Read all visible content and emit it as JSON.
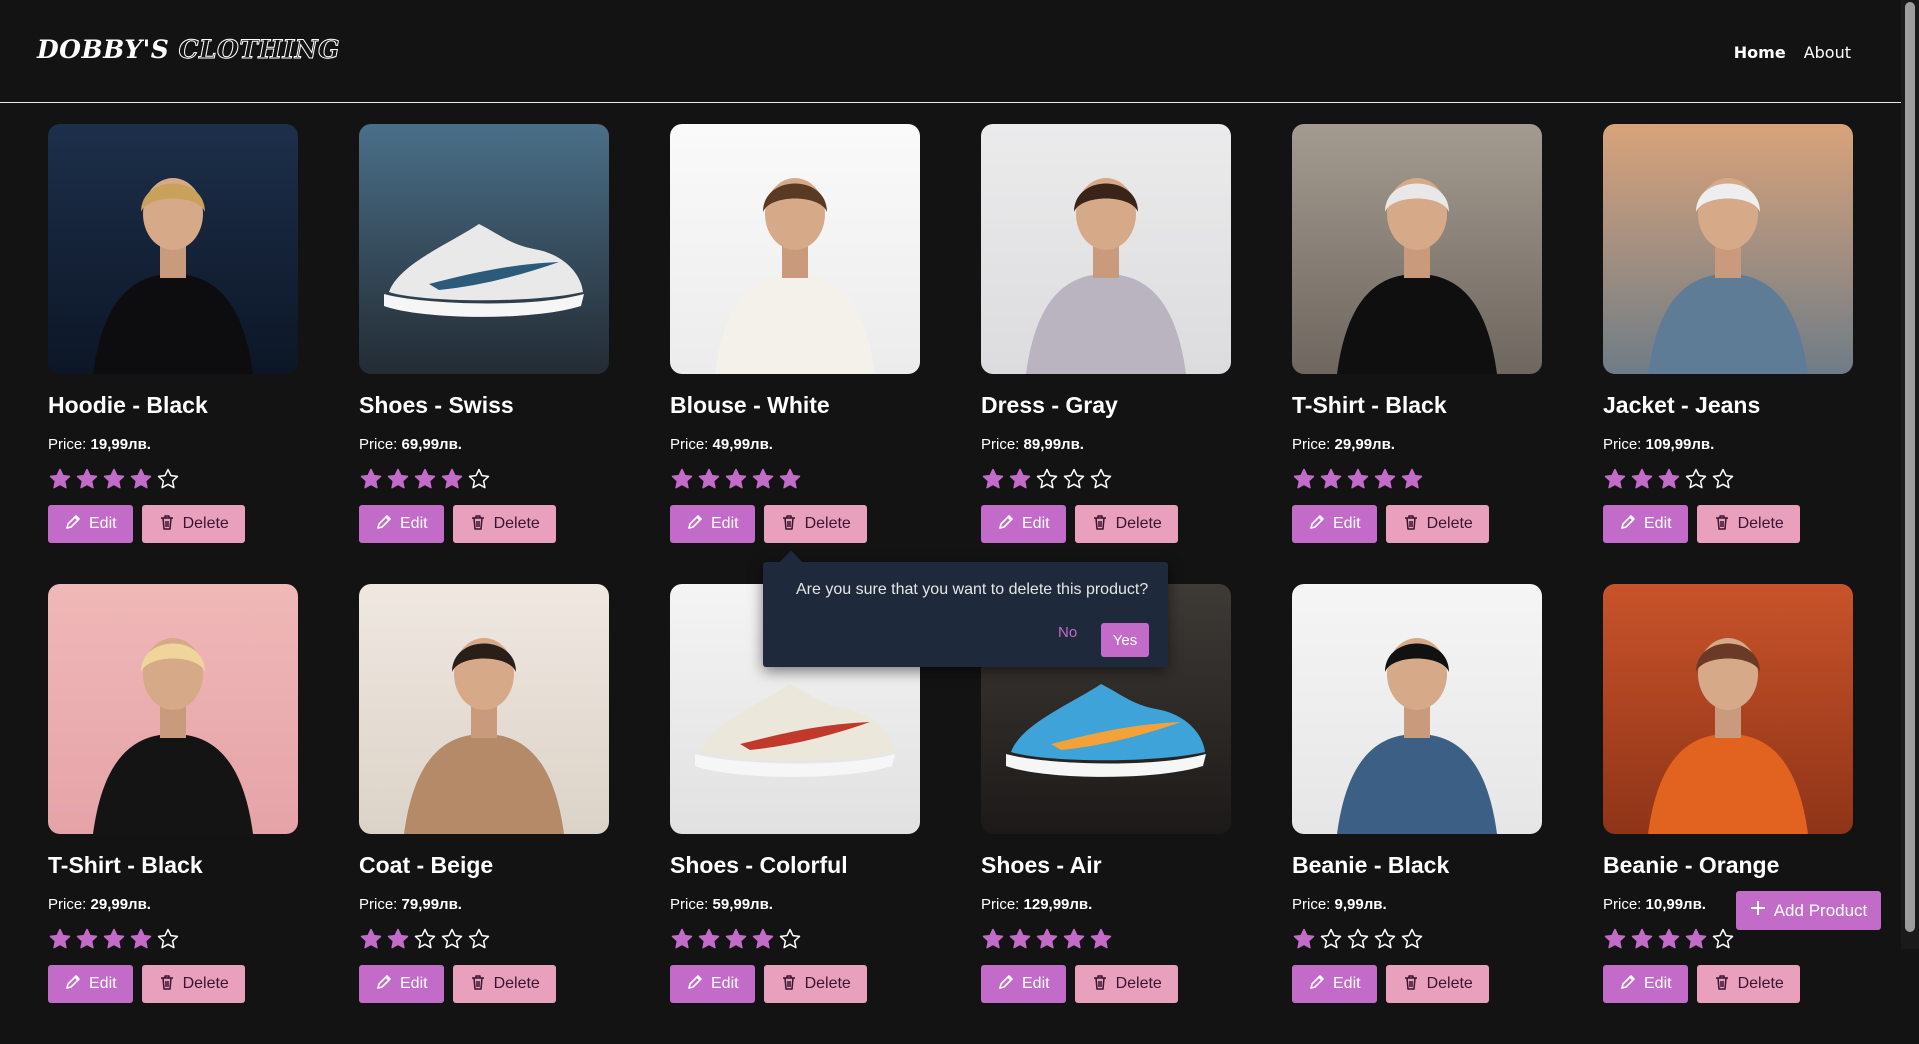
{
  "brand": {
    "logo_part1": "DOBBY'S",
    "logo_part2": "CLOTHING"
  },
  "nav": {
    "home": "Home",
    "about": "About"
  },
  "labels": {
    "price": "Price:",
    "edit": "Edit",
    "delete": "Delete"
  },
  "colors": {
    "accent": "#c36bc8",
    "delete_bg": "#e9a0bc",
    "background": "#131314",
    "popover_bg": "#1e293b"
  },
  "products": [
    {
      "title": "Hoodie - Black",
      "price": "19,99лв.",
      "rating": 4
    },
    {
      "title": "Shoes - Swiss",
      "price": "69,99лв.",
      "rating": 4
    },
    {
      "title": "Blouse - White",
      "price": "49,99лв.",
      "rating": 5
    },
    {
      "title": "Dress - Gray",
      "price": "89,99лв.",
      "rating": 2
    },
    {
      "title": "T-Shirt - Black",
      "price": "29,99лв.",
      "rating": 5
    },
    {
      "title": "Jacket - Jeans",
      "price": "109,99лв.",
      "rating": 3
    },
    {
      "title": "T-Shirt - Black",
      "price": "29,99лв.",
      "rating": 4
    },
    {
      "title": "Coat - Beige",
      "price": "79,99лв.",
      "rating": 2
    },
    {
      "title": "Shoes - Colorful",
      "price": "59,99лв.",
      "rating": 4
    },
    {
      "title": "Shoes - Air",
      "price": "129,99лв.",
      "rating": 5
    },
    {
      "title": "Beanie - Black",
      "price": "9,99лв.",
      "rating": 1
    },
    {
      "title": "Beanie - Orange",
      "price": "10,99лв.",
      "rating": 4
    }
  ],
  "confirm_popover": {
    "message": "Are you sure that you want to delete this product?",
    "no": "No",
    "yes": "Yes"
  },
  "add_product": {
    "label": "Add Product"
  }
}
